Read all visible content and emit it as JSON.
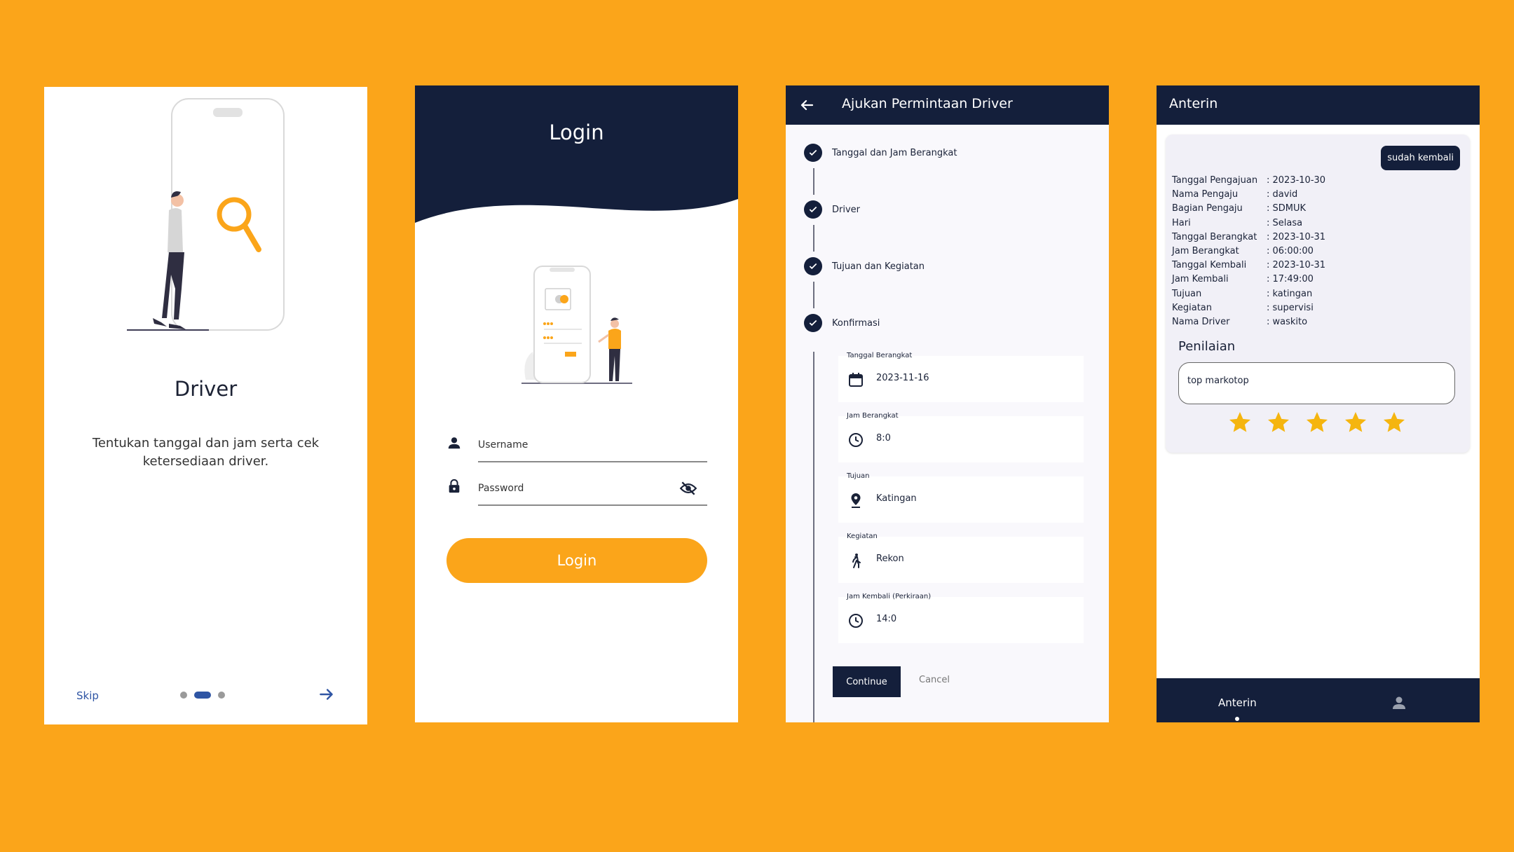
{
  "colors": {
    "background": "#FBA51A",
    "navy": "#141f3b",
    "accent_orange": "#FBA51A",
    "accent_blue": "#2f55a4",
    "star": "#F5B50F"
  },
  "onboarding": {
    "title": "Driver",
    "description": "Tentukan tanggal dan jam serta cek ketersediaan driver.",
    "skip_label": "Skip",
    "page_indicator": {
      "total": 3,
      "active": 2
    },
    "next_icon": "arrow-right-icon"
  },
  "login": {
    "title": "Login",
    "username_placeholder": "Username",
    "password_placeholder": "Password",
    "username_icon": "person-icon",
    "password_icon": "lock-icon",
    "visibility_icon": "eye-off-icon",
    "button_label": "Login"
  },
  "request": {
    "title": "Ajukan Permintaan Driver",
    "back_icon": "arrow-left-icon",
    "steps": [
      {
        "label": "Tanggal dan Jam Berangkat"
      },
      {
        "label": "Driver"
      },
      {
        "label": "Tujuan dan Kegiatan"
      },
      {
        "label": "Konfirmasi"
      }
    ],
    "fields": [
      {
        "label": "Tanggal Berangkat",
        "value": "2023-11-16",
        "icon": "calendar-icon"
      },
      {
        "label": "Jam Berangkat",
        "value": "8:0",
        "icon": "clock-icon"
      },
      {
        "label": "Tujuan",
        "value": "Katingan",
        "icon": "location-pin-icon"
      },
      {
        "label": "Kegiatan",
        "value": "Rekon",
        "icon": "walking-person-icon"
      },
      {
        "label": "Jam Kembali (Perkiraan)",
        "value": "14:0",
        "icon": "clock-icon"
      }
    ],
    "continue_label": "Continue",
    "cancel_label": "Cancel"
  },
  "detail": {
    "title": "Anterin",
    "status_badge": "sudah kembali",
    "info": [
      {
        "key": "Tanggal Pengajuan",
        "value": ": 2023-10-30"
      },
      {
        "key": "Nama Pengaju",
        "value": ": david"
      },
      {
        "key": "Bagian Pengaju",
        "value": ": SDMUK"
      },
      {
        "key": "Hari",
        "value": ": Selasa"
      },
      {
        "key": "Tanggal Berangkat",
        "value": ": 2023-10-31"
      },
      {
        "key": "Jam Berangkat",
        "value": ": 06:00:00"
      },
      {
        "key": "Tanggal Kembali",
        "value": ": 2023-10-31"
      },
      {
        "key": "Jam Kembali",
        "value": ": 17:49:00"
      },
      {
        "key": "Tujuan",
        "value": ": katingan"
      },
      {
        "key": "Kegiatan",
        "value": ": supervisi"
      },
      {
        "key": "Nama Driver",
        "value": ": waskito"
      }
    ],
    "rating_title": "Penilaian",
    "review_text": "top markotop",
    "rating": 5,
    "rating_max": 5,
    "bottom_tab_label": "Anterin",
    "profile_icon": "person-icon"
  }
}
